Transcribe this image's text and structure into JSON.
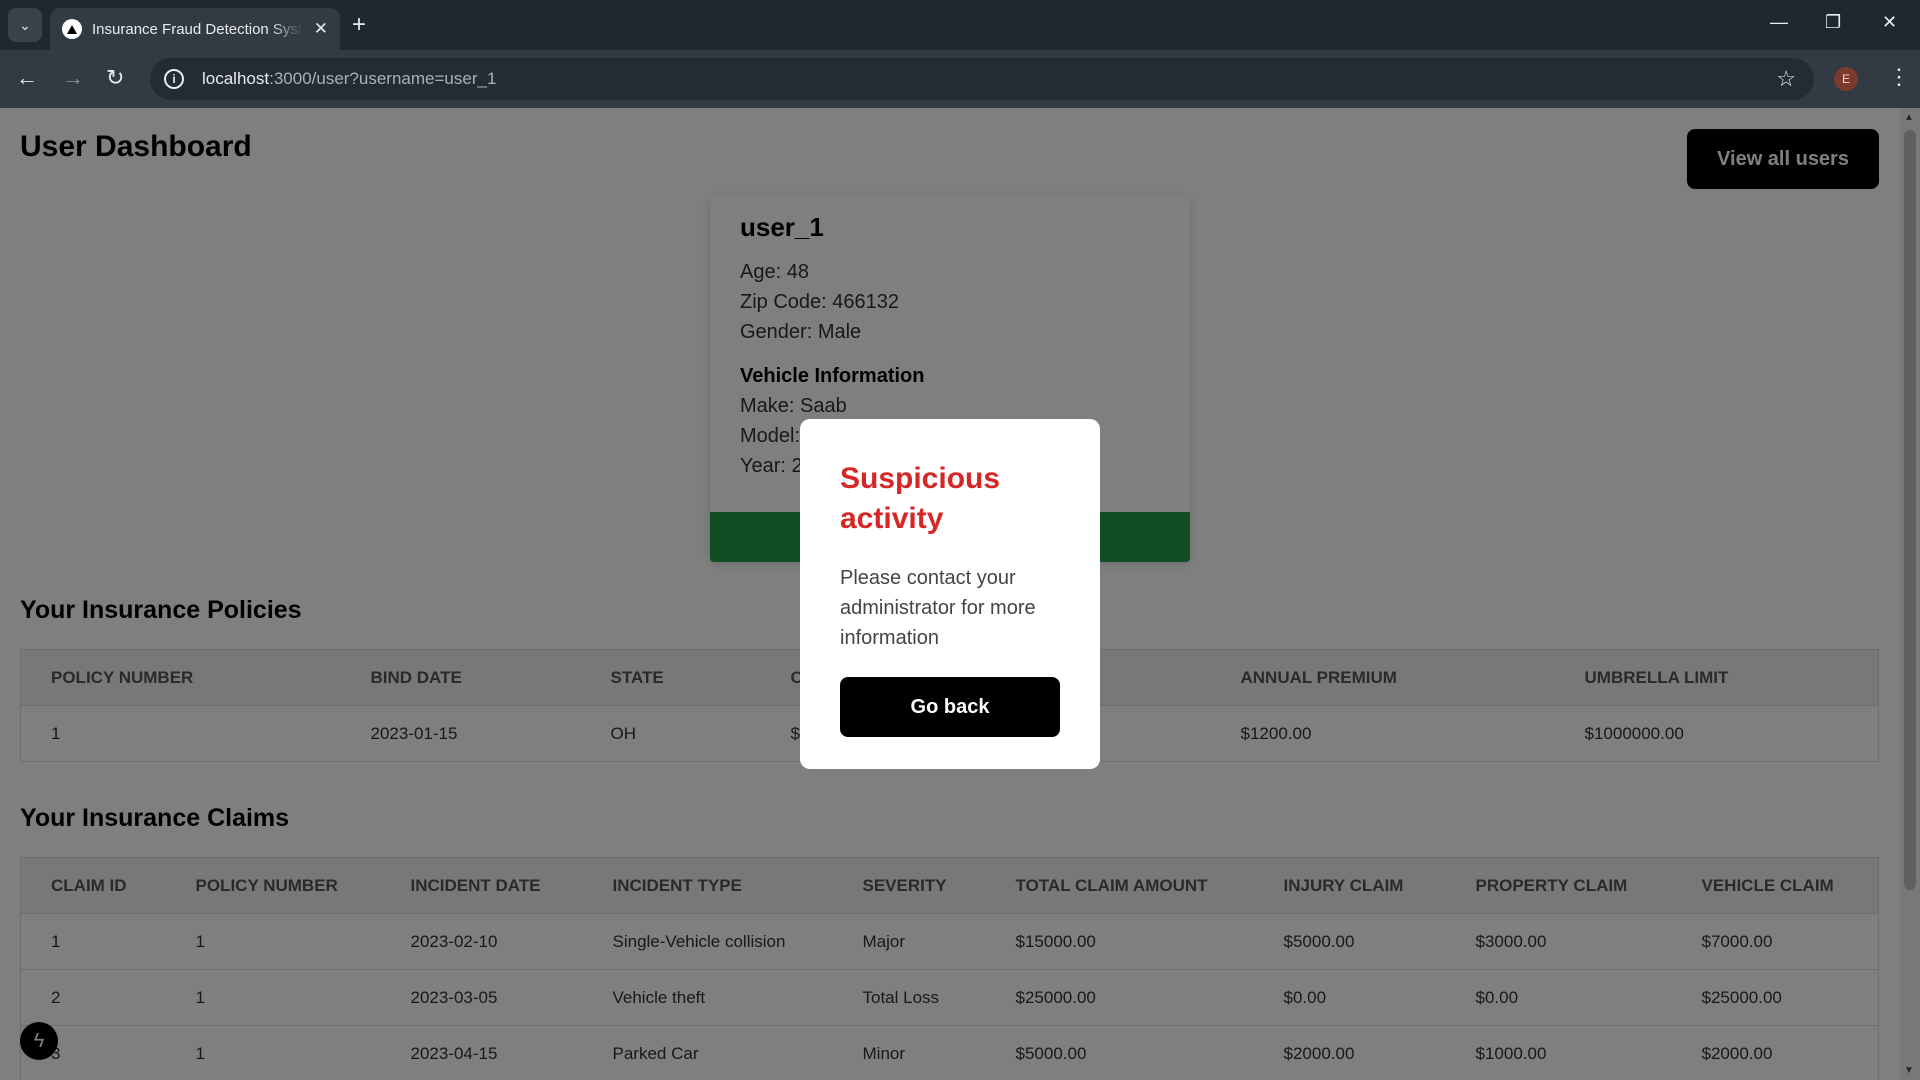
{
  "browser": {
    "tab_title": "Insurance Fraud Detection System",
    "url_host": "localhost",
    "url_rest": ":3000/user?username=user_1",
    "profile_initial": "E"
  },
  "page": {
    "title": "User Dashboard",
    "view_all_label": "View all users"
  },
  "user": {
    "name": "user_1",
    "age": "Age: 48",
    "zip": "Zip Code: 466132",
    "gender": "Gender: Male",
    "vehicle_heading": "Vehicle Information",
    "make": "Make: Saab",
    "model": "Model:",
    "year": "Year: 2"
  },
  "policies": {
    "title": "Your Insurance Policies",
    "columns": [
      "Policy Number",
      "Bind Date",
      "State",
      "C",
      "",
      "Annual Premium",
      "Umbrella Limit"
    ],
    "rows": [
      [
        "1",
        "2023-01-15",
        "OH",
        "$",
        "",
        "$1200.00",
        "$1000000.00"
      ]
    ]
  },
  "claims": {
    "title": "Your Insurance Claims",
    "columns": [
      "Claim ID",
      "Policy Number",
      "Incident Date",
      "Incident Type",
      "Severity",
      "Total Claim Amount",
      "Injury Claim",
      "Property Claim",
      "Vehicle Claim"
    ],
    "rows": [
      [
        "1",
        "1",
        "2023-02-10",
        "Single-Vehicle collision",
        "Major",
        "$15000.00",
        "$5000.00",
        "$3000.00",
        "$7000.00"
      ],
      [
        "2",
        "1",
        "2023-03-05",
        "Vehicle theft",
        "Total Loss",
        "$25000.00",
        "$0.00",
        "$0.00",
        "$25000.00"
      ],
      [
        "3",
        "1",
        "2023-04-15",
        "Parked Car",
        "Minor",
        "$5000.00",
        "$2000.00",
        "$1000.00",
        "$2000.00"
      ]
    ]
  },
  "modal": {
    "title": "Suspicious activity",
    "message": "Please contact your administrator for more information",
    "button": "Go back"
  },
  "colors": {
    "alert_red": "#d72626",
    "card_footer_green": "#1e9e46"
  }
}
